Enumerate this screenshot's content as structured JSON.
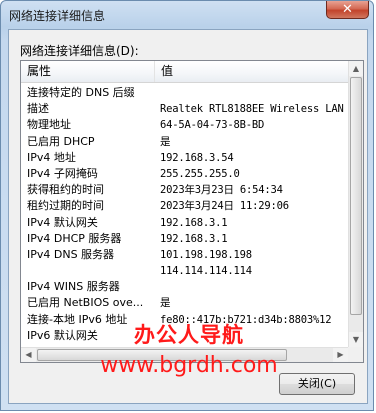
{
  "window": {
    "title": "网络连接详细信息",
    "close_glyph": "✕"
  },
  "group_label": "网络连接详细信息(D):",
  "table": {
    "headers": {
      "property": "属性",
      "value": "值"
    },
    "rows": [
      {
        "property": "连接特定的 DNS 后缀",
        "value": ""
      },
      {
        "property": "描述",
        "value": "Realtek RTL8188EE Wireless LAN"
      },
      {
        "property": "物理地址",
        "value": "64-5A-04-73-8B-BD"
      },
      {
        "property": "已启用 DHCP",
        "value": "是"
      },
      {
        "property": "IPv4 地址",
        "value": "192.168.3.54"
      },
      {
        "property": "IPv4 子网掩码",
        "value": "255.255.255.0"
      },
      {
        "property": "获得租约的时间",
        "value": "2023年3月23日 6:54:34"
      },
      {
        "property": "租约过期的时间",
        "value": "2023年3月24日 11:29:06"
      },
      {
        "property": "IPv4 默认网关",
        "value": "192.168.3.1"
      },
      {
        "property": "IPv4 DHCP 服务器",
        "value": "192.168.3.1"
      },
      {
        "property": "IPv4 DNS 服务器",
        "value": "101.198.198.198"
      },
      {
        "property": "",
        "value": "114.114.114.114"
      },
      {
        "property": "IPv4 WINS 服务器",
        "value": ""
      },
      {
        "property": "已启用 NetBIOS ove...",
        "value": "是"
      },
      {
        "property": "连接-本地 IPv6 地址",
        "value": "fe80::417b:b721:d34b:8803%12"
      },
      {
        "property": "IPv6 默认网关",
        "value": ""
      }
    ]
  },
  "close_button_label": "关闭(C)",
  "watermark": {
    "line1": "办公人导航",
    "line2": "www.bgrdh.com"
  },
  "colors": {
    "titlebar": "#b9d1ea",
    "close_red": "#c2432b",
    "watermark_red": "#ff1a1a"
  }
}
